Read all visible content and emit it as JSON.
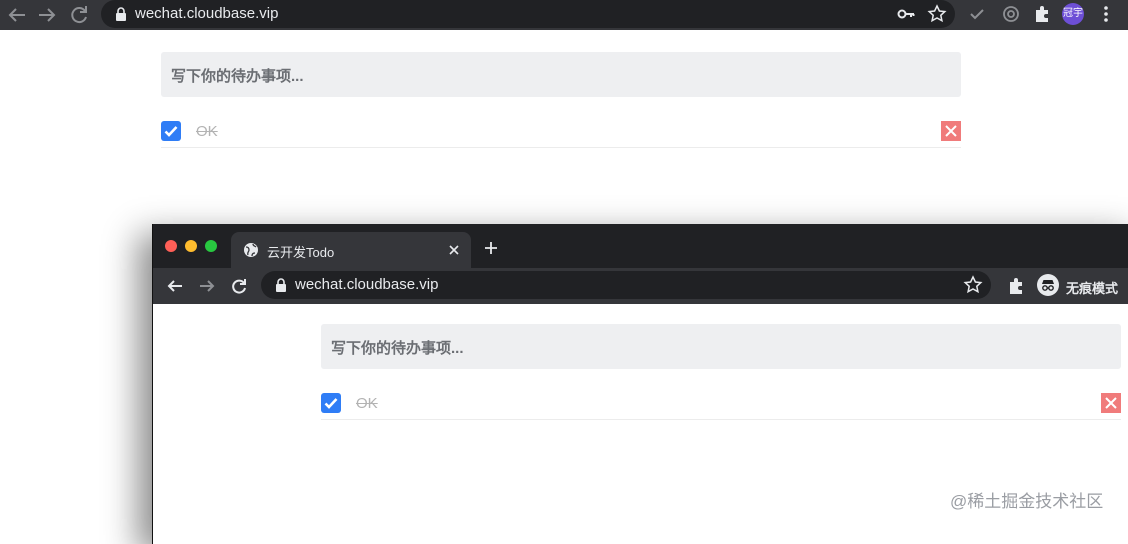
{
  "back_browser": {
    "url": "wechat.cloudbase.vip",
    "profile_label": "冠宇",
    "todo": {
      "placeholder": "写下你的待办事项...",
      "items": [
        {
          "text": "OK",
          "done": true
        }
      ]
    }
  },
  "front_browser": {
    "tab_title": "云开发Todo",
    "url": "wechat.cloudbase.vip",
    "incognito_label": "无痕模式",
    "todo": {
      "placeholder": "写下你的待办事项...",
      "items": [
        {
          "text": "OK",
          "done": true
        }
      ]
    }
  },
  "watermark": "@稀土掘金技术社区",
  "colors": {
    "checkbox": "#2f7df6",
    "delete": "#f07b7b",
    "toolbar": "#35363a",
    "omnibox": "#202124"
  }
}
